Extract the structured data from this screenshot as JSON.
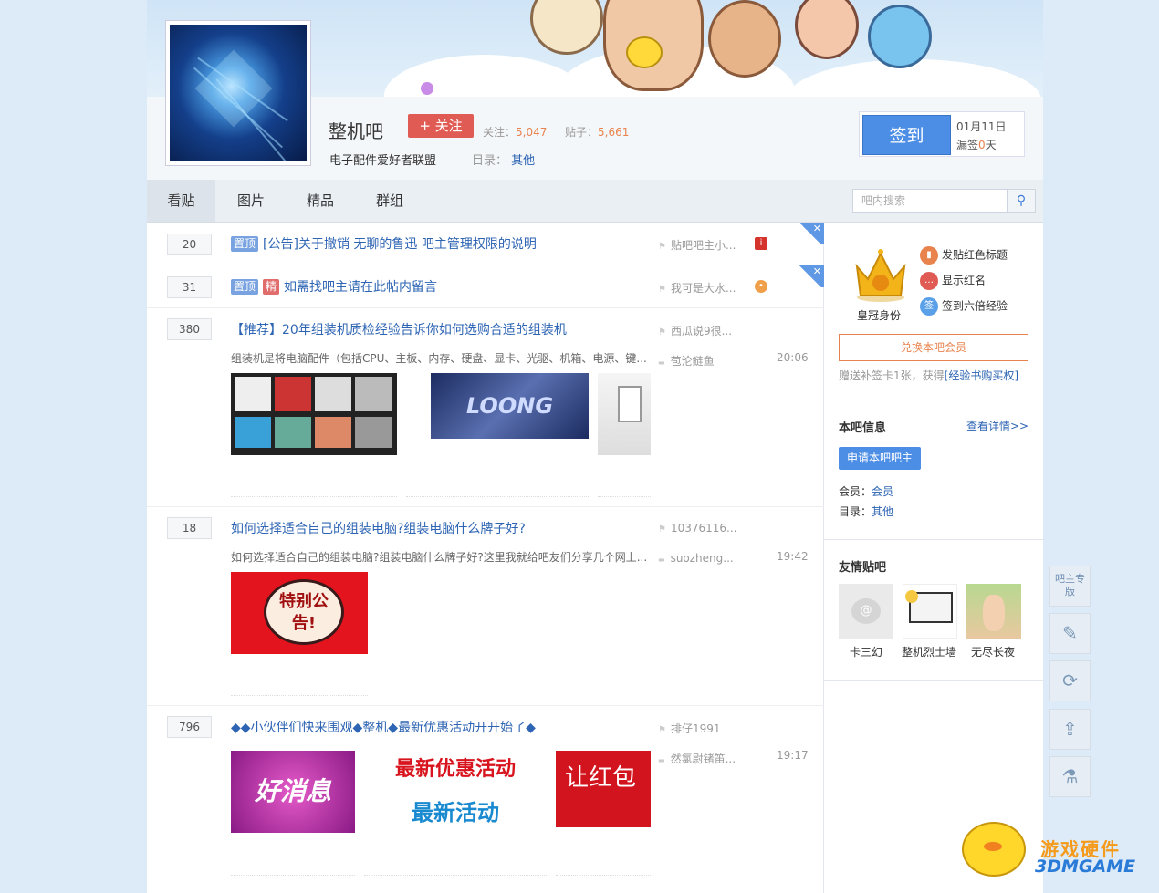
{
  "forum": {
    "name": "整机吧",
    "follow_label": "+ 关注",
    "followers_label": "关注：",
    "followers": "5,047",
    "posts_label": "贴子：",
    "posts": "5,661",
    "slogan": "电子配件爱好者联盟",
    "dir_label": "目录：",
    "dir_value": "其他"
  },
  "sign": {
    "button": "签到",
    "date": "01月11日",
    "missed_prefix": "漏签",
    "missed_count": "0",
    "missed_suffix": "天"
  },
  "nav": {
    "tabs": [
      "看贴",
      "图片",
      "精品",
      "群组"
    ],
    "active": "看贴",
    "search_placeholder": "吧内搜索"
  },
  "threads": [
    {
      "replies": "20",
      "badges": [
        "置顶"
      ],
      "title": "[公告]关于撤销 无聊的鲁迅 吧主管理权限的说明",
      "author": "贴吧吧主小..."
    },
    {
      "replies": "31",
      "badges": [
        "置顶",
        "精"
      ],
      "title": "如需找吧主请在此帖内留言",
      "author": "我可是大水..."
    },
    {
      "replies": "380",
      "title": "【推荐】20年组装机质检经验告诉你如何选购合适的组装机",
      "author": "西瓜说9很...",
      "abstract": "组装机是将电脑配件（包括CPU、主板、内存、硬盘、显卡、光驱、机箱、电源、键...",
      "last_reply": "苞沦鲢鱼",
      "time": "20:06",
      "image_text": "LOONG"
    },
    {
      "replies": "18",
      "title": "如何选择适合自己的组装电脑?组装电脑什么牌子好?",
      "author": "10376116...",
      "abstract": "如何选择适合自己的组装电脑?组装电脑什么牌子好?这里我就给吧友们分享几个网上...",
      "last_reply": "suozheng...",
      "time": "19:42",
      "image_text": "特别公告!"
    },
    {
      "replies": "796",
      "title": "◆◆小伙伴们快来围观◆整机◆最新优惠活动开开始了◆",
      "author": "排仔1991",
      "last_reply": "然氯尉锗笛...",
      "time": "19:17",
      "image_texts": [
        "好消息",
        "最新优惠活动",
        "最新活动",
        "让红包"
      ]
    }
  ],
  "sidebar": {
    "crown_label": "皇冠身份",
    "perks": [
      "发贴红色标题",
      "显示红名",
      "签到六倍经验"
    ],
    "exchange_button": "兑换本吧会员",
    "gift_text": "赠送补签卡1张，获得",
    "gift_link": "[经验书购买权]",
    "info_title": "本吧信息",
    "info_more": "查看详情>>",
    "apply_button": "申请本吧吧主",
    "member_label": "会员：",
    "member_value": "会员",
    "dir_label": "目录：",
    "dir_value": "其他",
    "friends_title": "友情贴吧",
    "friends": [
      "卡三幻",
      "整机烈士墙",
      "无尽长夜"
    ]
  },
  "right_tools": {
    "admin_label": "吧主专版",
    "icons": [
      "edit-icon",
      "refresh-icon",
      "share-icon",
      "lab-icon"
    ]
  },
  "watermark": {
    "line1": "游戏硬件",
    "line2": "3DMGAME"
  },
  "colors": {
    "accent": "#2d64b3",
    "button_blue": "#4c8de6",
    "follow_red": "#e05b54",
    "orange": "#e8834e"
  }
}
